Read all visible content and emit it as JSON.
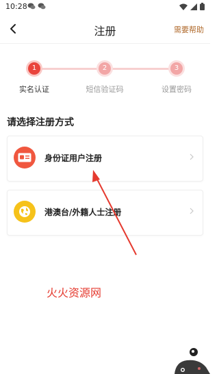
{
  "status_bar": {
    "time": "10:28"
  },
  "header": {
    "title": "注册",
    "help_label": "需要帮助"
  },
  "steps": [
    {
      "number": "1",
      "label": "实名认证",
      "active": true
    },
    {
      "number": "2",
      "label": "短信验证码",
      "active": false
    },
    {
      "number": "3",
      "label": "设置密码",
      "active": false
    }
  ],
  "section_title": "请选择注册方式",
  "options": [
    {
      "label": "身份证用户注册",
      "icon": "id-card-icon"
    },
    {
      "label": "港澳台/外籍人士注册",
      "icon": "globe-icon"
    }
  ],
  "annotation": "火火资源网",
  "colors": {
    "accent": "#e9443c",
    "help": "#b06a2c",
    "annotation": "#e53a2f"
  }
}
